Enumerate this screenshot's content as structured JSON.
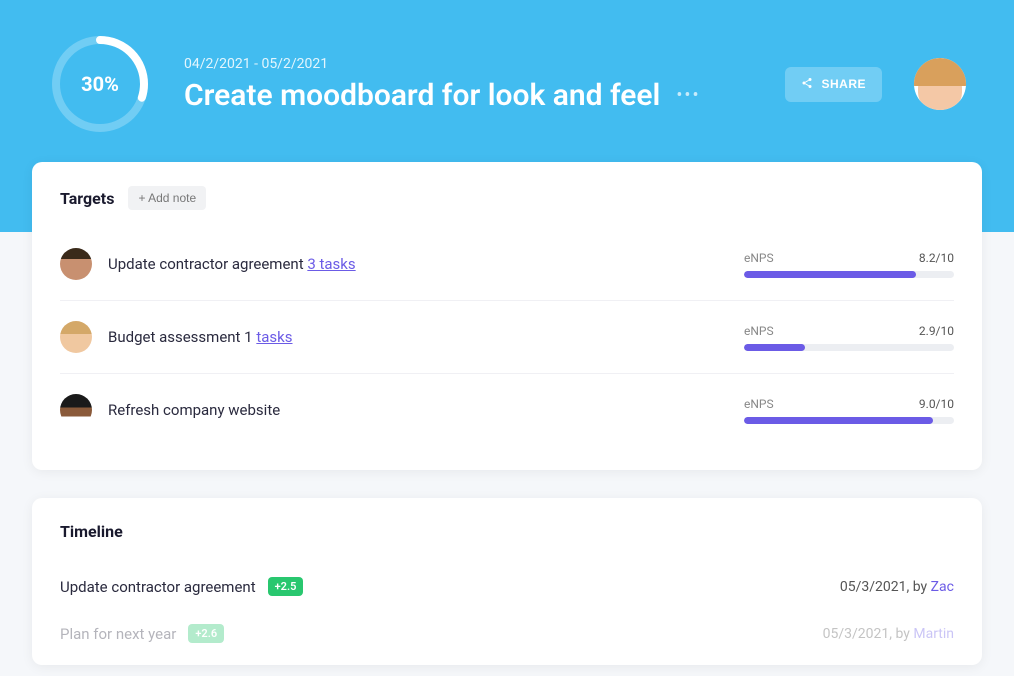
{
  "header": {
    "progress_percent": 30,
    "progress_label": "30%",
    "date_range": "04/2/2021 - 05/2/2021",
    "title": "Create moodboard for look and feel",
    "share_label": "SHARE"
  },
  "targets": {
    "section_title": "Targets",
    "add_note_label": "+ Add note",
    "items": [
      {
        "title": "Update contractor agreement",
        "tasks_label": "3 tasks",
        "metric_label": "eNPS",
        "metric_value": "8.2/10",
        "bar_pct": 82
      },
      {
        "title": "Budget assessment 1",
        "tasks_label": "tasks",
        "metric_label": "eNPS",
        "metric_value": "2.9/10",
        "bar_pct": 29
      },
      {
        "title": "Refresh company website",
        "tasks_label": "",
        "metric_label": "eNPS",
        "metric_value": "9.0/10",
        "bar_pct": 90
      }
    ]
  },
  "timeline": {
    "section_title": "Timeline",
    "items": [
      {
        "title": "Update contractor agreement",
        "badge": "+2.5",
        "date": "05/3/2021",
        "by": "by",
        "author": "Zac",
        "faded": false
      },
      {
        "title": "Plan for next year",
        "badge": "+2.6",
        "date": "05/3/2021",
        "by": "by",
        "author": "Martin",
        "faded": true
      }
    ]
  }
}
